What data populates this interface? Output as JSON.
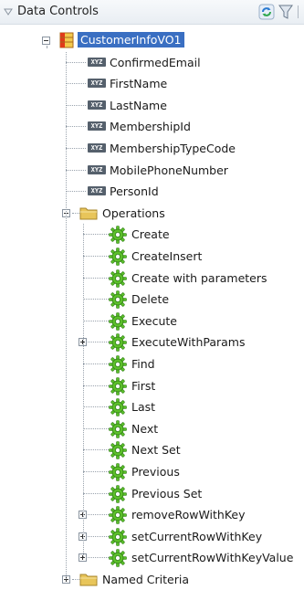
{
  "header": {
    "title": "Data Controls"
  },
  "tree": {
    "root": {
      "label": "CustomerInfoVO1"
    },
    "attributes": [
      "ConfirmedEmail",
      "FirstName",
      "LastName",
      "MembershipId",
      "MembershipTypeCode",
      "MobilePhoneNumber",
      "PersonId"
    ],
    "attribute_badge": "XYZ",
    "operations_folder": "Operations",
    "operations": [
      {
        "label": "Create",
        "expandable": false
      },
      {
        "label": "CreateInsert",
        "expandable": false
      },
      {
        "label": "Create with parameters",
        "expandable": false
      },
      {
        "label": "Delete",
        "expandable": false
      },
      {
        "label": "Execute",
        "expandable": false
      },
      {
        "label": "ExecuteWithParams",
        "expandable": true
      },
      {
        "label": "Find",
        "expandable": false
      },
      {
        "label": "First",
        "expandable": false
      },
      {
        "label": "Last",
        "expandable": false
      },
      {
        "label": "Next",
        "expandable": false
      },
      {
        "label": "Next Set",
        "expandable": false
      },
      {
        "label": "Previous",
        "expandable": false
      },
      {
        "label": "Previous Set",
        "expandable": false
      },
      {
        "label": "removeRowWithKey",
        "expandable": true
      },
      {
        "label": "setCurrentRowWithKey",
        "expandable": true
      },
      {
        "label": "setCurrentRowWithKeyValue",
        "expandable": true
      }
    ],
    "named_criteria_folder": "Named Criteria"
  },
  "icons": {
    "collapse": "triangle-down-icon",
    "refresh": "refresh-icon",
    "filter": "filter-icon",
    "view_object": "view-object-icon",
    "attribute": "attribute-icon",
    "folder": "folder-icon",
    "operation": "gear-icon"
  },
  "colors": {
    "selection": "#3a6fc2",
    "gear": "#5cbf2a",
    "folder": "#e8c55a",
    "view_object": "#e03a1a"
  }
}
